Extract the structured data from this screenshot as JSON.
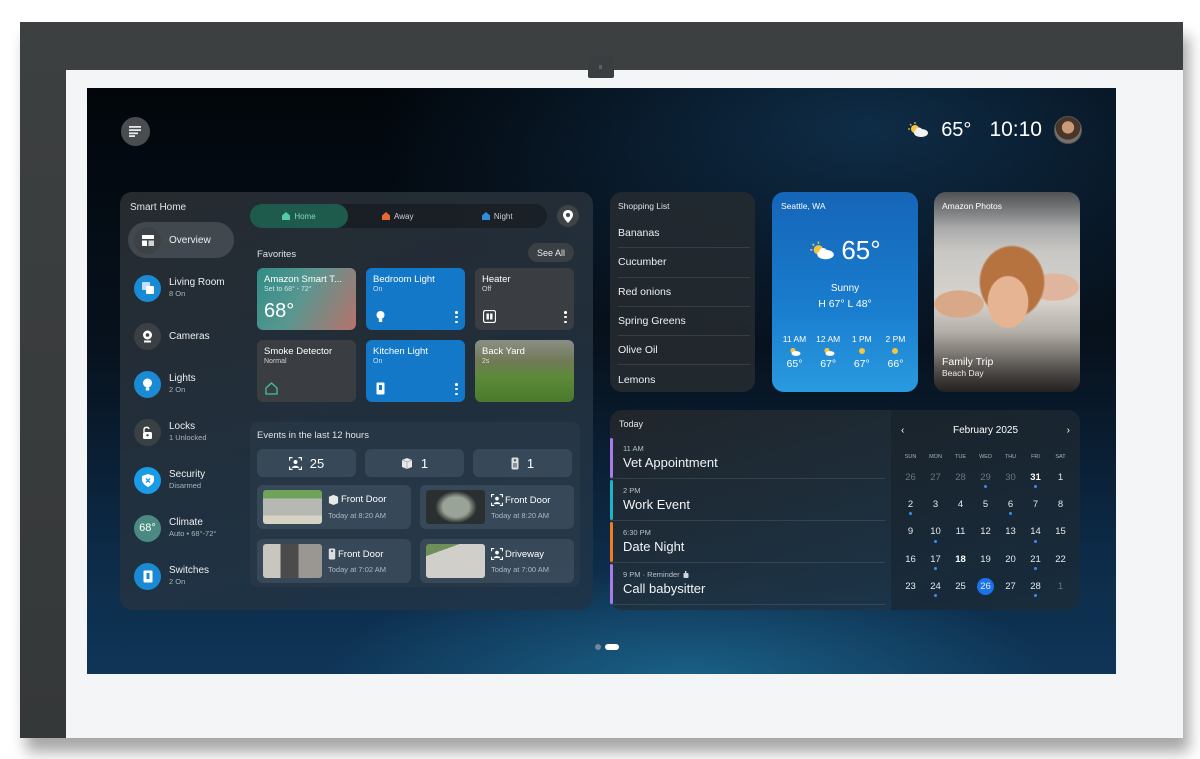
{
  "header": {
    "weather_icon": "partly-sunny-icon",
    "temperature": "65°",
    "time": "10:10"
  },
  "smart_home": {
    "title": "Smart Home",
    "nav": [
      {
        "label": "Overview",
        "sub": "",
        "icon": "overview-grid-icon",
        "color": "#3d4246",
        "active": true
      },
      {
        "label": "Living Room",
        "sub": "8 On",
        "icon": "room-icon",
        "color": "#1a8ad4"
      },
      {
        "label": "Cameras",
        "sub": "",
        "icon": "camera-icon",
        "color": "#3b4045"
      },
      {
        "label": "Lights",
        "sub": "2 On",
        "icon": "lightbulb-icon",
        "color": "#1a8ad4"
      },
      {
        "label": "Locks",
        "sub": "1 Unlocked",
        "icon": "unlocked-icon",
        "color": "#3b4045"
      },
      {
        "label": "Security",
        "sub": "Disarmed",
        "icon": "shield-icon",
        "color": "#1a9be6"
      },
      {
        "label": "Climate",
        "sub": "Auto • 68°-72°",
        "icon": "thermostat-icon",
        "badge": "68°",
        "color": "#4b8a82"
      },
      {
        "label": "Switches",
        "sub": "2 On",
        "icon": "switch-icon",
        "color": "#1a8ad4"
      }
    ],
    "modes": [
      {
        "label": "Home",
        "color": "#56c9a8",
        "active": true
      },
      {
        "label": "Away",
        "color": "#e8692f"
      },
      {
        "label": "Night",
        "color": "#2f8de0"
      }
    ],
    "favorites": {
      "title": "Favorites",
      "see_all": "See All",
      "tiles": [
        {
          "name": "Amazon Smart T...",
          "sub": "Set to 68° - 72°",
          "value": "68°"
        },
        {
          "name": "Bedroom Light",
          "sub": "On"
        },
        {
          "name": "Heater",
          "sub": "Off"
        },
        {
          "name": "Smoke Detector",
          "sub": "Normal"
        },
        {
          "name": "Kitchen Light",
          "sub": "On"
        },
        {
          "name": "Back Yard",
          "sub": "2s"
        }
      ]
    },
    "events": {
      "title": "Events in the last 12 hours",
      "counts": [
        {
          "icon": "person-detect-icon",
          "value": "25"
        },
        {
          "icon": "package-icon",
          "value": "1"
        },
        {
          "icon": "doorbell-icon",
          "value": "1"
        }
      ],
      "items": [
        {
          "icon": "package-icon",
          "title": "Front Door",
          "time": "Today at 8:20 AM"
        },
        {
          "icon": "person-detect-icon",
          "title": "Front Door",
          "time": "Today at 8:20 AM"
        },
        {
          "icon": "doorbell-icon",
          "title": "Front Door",
          "time": "Today at 7:02 AM"
        },
        {
          "icon": "person-detect-icon",
          "title": "Driveway",
          "time": "Today at 7:00 AM"
        }
      ]
    }
  },
  "shopping": {
    "title": "Shopping List",
    "items": [
      "Bananas",
      "Cucumber",
      "Red onions",
      "Spring Greens",
      "Olive Oil",
      "Lemons"
    ]
  },
  "weather": {
    "city": "Seattle, WA",
    "temp": "65°",
    "condition": "Sunny",
    "high_low": "H 67°  L 48°",
    "hourly": [
      {
        "hour": "11 AM",
        "icon": "partly-cloudy-icon",
        "temp": "65°"
      },
      {
        "hour": "12 AM",
        "icon": "partly-cloudy-icon",
        "temp": "67°"
      },
      {
        "hour": "1 PM",
        "icon": "sun-icon",
        "temp": "67°"
      },
      {
        "hour": "2 PM",
        "icon": "sun-icon",
        "temp": "66°"
      }
    ]
  },
  "photos": {
    "title": "Amazon Photos",
    "caption": "Family Trip",
    "subcaption": "Beach Day"
  },
  "today": {
    "title": "Today",
    "events": [
      {
        "time": "11 AM",
        "name": "Vet Appointment",
        "color": "#a77be8"
      },
      {
        "time": "2 PM",
        "name": "Work Event",
        "color": "#1fb3c9"
      },
      {
        "time": "6:30 PM",
        "name": "Date Night",
        "color": "#ee7c24"
      },
      {
        "time": "9 PM · Reminder",
        "name": "Call babysitter",
        "color": "#a77be8",
        "reminder": true
      }
    ]
  },
  "calendar": {
    "month": "February 2025",
    "weekdays": [
      "SUN",
      "MON",
      "TUE",
      "WED",
      "THU",
      "FRI",
      "SAT"
    ],
    "days": [
      {
        "d": "26",
        "dim": true
      },
      {
        "d": "27",
        "dim": true
      },
      {
        "d": "28",
        "dim": true
      },
      {
        "d": "29",
        "dim": true,
        "dot": true
      },
      {
        "d": "30",
        "dim": true
      },
      {
        "d": "31",
        "bold": true,
        "dot": true
      },
      {
        "d": "1"
      },
      {
        "d": "2",
        "dot": true
      },
      {
        "d": "3"
      },
      {
        "d": "4"
      },
      {
        "d": "5"
      },
      {
        "d": "6",
        "dot": true
      },
      {
        "d": "7"
      },
      {
        "d": "8"
      },
      {
        "d": "9"
      },
      {
        "d": "10",
        "dot": true
      },
      {
        "d": "11"
      },
      {
        "d": "12"
      },
      {
        "d": "13"
      },
      {
        "d": "14",
        "dot": true
      },
      {
        "d": "15"
      },
      {
        "d": "16"
      },
      {
        "d": "17",
        "dot": true
      },
      {
        "d": "18",
        "bold": true
      },
      {
        "d": "19"
      },
      {
        "d": "20"
      },
      {
        "d": "21",
        "dot": true
      },
      {
        "d": "22"
      },
      {
        "d": "23"
      },
      {
        "d": "24",
        "dot": true
      },
      {
        "d": "25"
      },
      {
        "d": "26",
        "selected": true
      },
      {
        "d": "27"
      },
      {
        "d": "28",
        "dot": true
      },
      {
        "d": "1",
        "dim": true
      }
    ]
  },
  "pager": {
    "pages": 2,
    "current": 2
  }
}
